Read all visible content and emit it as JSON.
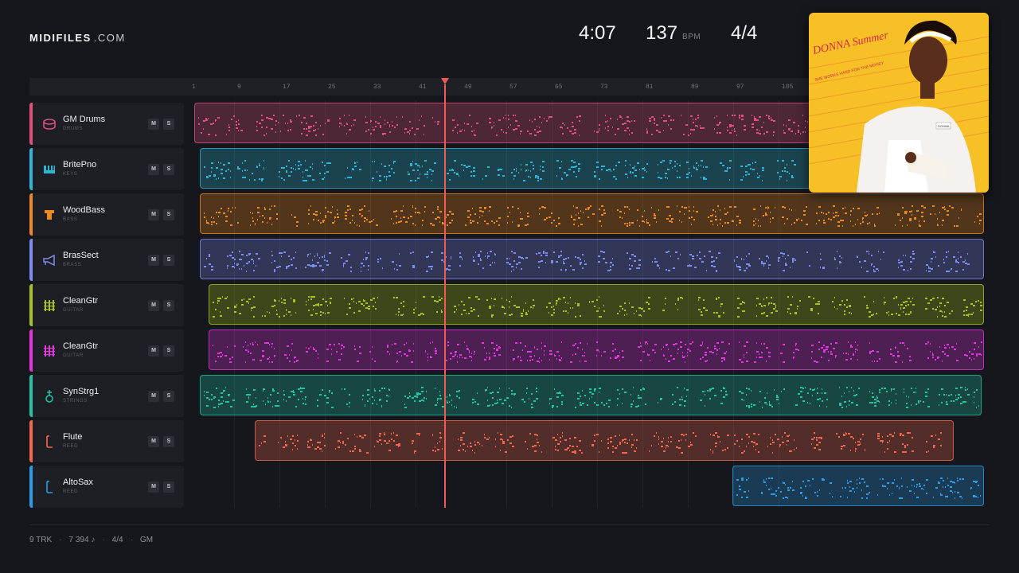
{
  "header": {
    "brand": "MIDIFILES",
    "tld": ".COM",
    "duration": "4:07",
    "tempo": "137",
    "tempo_unit": "BPM",
    "time_signature": "4/4"
  },
  "ruler": {
    "bar_labels": [
      "1",
      "9",
      "17",
      "25",
      "33",
      "41",
      "49",
      "57",
      "65",
      "73",
      "81",
      "89",
      "97",
      "105"
    ]
  },
  "tracks": [
    {
      "name": "GM Drums",
      "category": "DRUMS",
      "color": "#e0507e",
      "icon": "drum-icon",
      "mute": "M",
      "solo": "S"
    },
    {
      "name": "BritePno",
      "category": "KEYS",
      "color": "#2cb6d3",
      "icon": "piano-icon",
      "mute": "M",
      "solo": "S"
    },
    {
      "name": "WoodBass",
      "category": "BASS",
      "color": "#ee8a1d",
      "icon": "bass-icon",
      "mute": "M",
      "solo": "S"
    },
    {
      "name": "BrasSect",
      "category": "BRASS",
      "color": "#7d8cf0",
      "icon": "brass-icon",
      "mute": "M",
      "solo": "S"
    },
    {
      "name": "CleanGtr",
      "category": "GUITAR",
      "color": "#a9c21e",
      "icon": "guitar-icon",
      "mute": "M",
      "solo": "S"
    },
    {
      "name": "CleanGtr",
      "category": "GUITAR",
      "color": "#e236dd",
      "icon": "guitar-icon",
      "mute": "M",
      "solo": "S"
    },
    {
      "name": "SynStrg1",
      "category": "STRINGS",
      "color": "#22c4a6",
      "icon": "strings-icon",
      "mute": "M",
      "solo": "S"
    },
    {
      "name": "Flute",
      "category": "REED",
      "color": "#f2684f",
      "icon": "flute-icon",
      "mute": "M",
      "solo": "S"
    },
    {
      "name": "AltoSax",
      "category": "REED",
      "color": "#2a9be6",
      "icon": "sax-icon",
      "mute": "M",
      "solo": "S"
    }
  ],
  "album_art": {
    "artist": "DONNA Summer",
    "title": "SHE WORKS HARD FOR THE MONEY",
    "badge": "DONNA"
  },
  "footer": {
    "tracks": "9 TRK",
    "notes": "7 394 ♪",
    "meter": "4/4",
    "standard": "GM"
  }
}
